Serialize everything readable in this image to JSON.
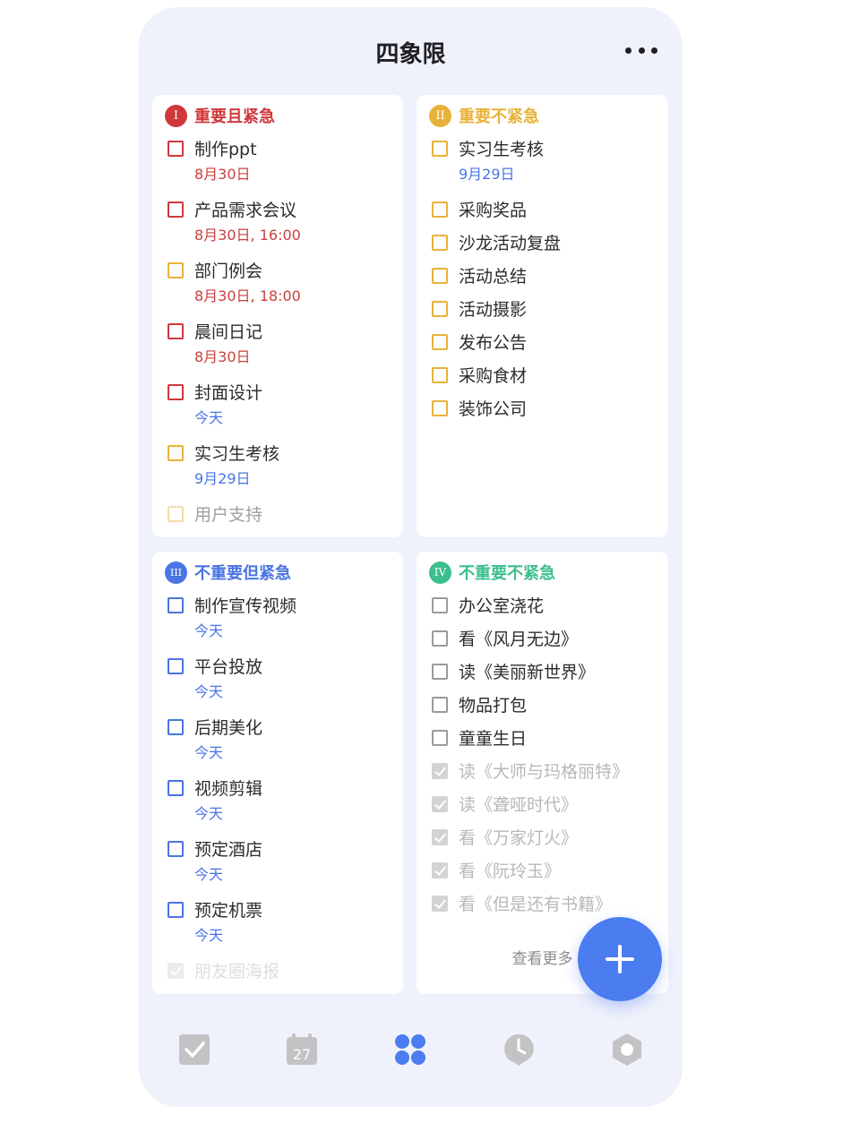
{
  "header": {
    "title": "四象限",
    "more_icon": "more-dots-icon"
  },
  "colors": {
    "q1": "#d0383a",
    "q2": "#e8b23a",
    "q3": "#4a74e3",
    "q4": "#3cbf8c",
    "accent": "#4b7cf0",
    "tab_inactive": "#c3c3c6"
  },
  "quadrants": [
    {
      "badge": "I",
      "title": "重要且紧急",
      "items": [
        {
          "name": "制作ppt",
          "date": "8月30日"
        },
        {
          "name": "产品需求会议",
          "date": "8月30日, 16:00"
        },
        {
          "name": "部门例会",
          "date": "8月30日, 18:00"
        },
        {
          "name": "晨间日记",
          "date": "8月30日"
        },
        {
          "name": "封面设计",
          "date": "今天"
        },
        {
          "name": "实习生考核",
          "date": "9月29日"
        },
        {
          "name": "用户支持"
        }
      ]
    },
    {
      "badge": "II",
      "title": "重要不紧急",
      "items": [
        {
          "name": "实习生考核",
          "date": "9月29日"
        },
        {
          "name": "采购奖品"
        },
        {
          "name": "沙龙活动复盘"
        },
        {
          "name": "活动总结"
        },
        {
          "name": "活动摄影"
        },
        {
          "name": "发布公告"
        },
        {
          "name": "采购食材"
        },
        {
          "name": "装饰公司"
        }
      ]
    },
    {
      "badge": "III",
      "title": "不重要但紧急",
      "items": [
        {
          "name": " 制作宣传视频",
          "date": "今天"
        },
        {
          "name": "平台投放",
          "date": "今天"
        },
        {
          "name": "后期美化",
          "date": "今天"
        },
        {
          "name": "视频剪辑",
          "date": "今天"
        },
        {
          "name": "预定酒店",
          "date": "今天"
        },
        {
          "name": "预定机票",
          "date": "今天"
        },
        {
          "name": "朋友圈海报"
        }
      ]
    },
    {
      "badge": "IV",
      "title": "不重要不紧急",
      "items": [
        {
          "name": "办公室浇花"
        },
        {
          "name": "看《风月无边》"
        },
        {
          "name": "读《美丽新世界》"
        },
        {
          "name": "物品打包"
        },
        {
          "name": "童童生日"
        },
        {
          "name": "读《大师与玛格丽特》"
        },
        {
          "name": "读《聋哑时代》"
        },
        {
          "name": "看《万家灯火》"
        },
        {
          "name": "看《阮玲玉》"
        },
        {
          "name": "看《但是还有书籍》"
        }
      ],
      "see_more": "查看更多"
    }
  ],
  "fab": {
    "icon": "plus-icon"
  },
  "tabbar": {
    "items": [
      {
        "icon": "checkbox-icon"
      },
      {
        "icon": "calendar-icon",
        "label": "27"
      },
      {
        "icon": "four-quadrant-icon",
        "active": true
      },
      {
        "icon": "clock-icon"
      },
      {
        "icon": "hexagon-settings-icon"
      }
    ]
  }
}
